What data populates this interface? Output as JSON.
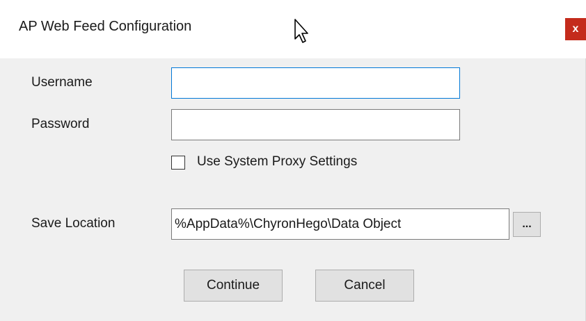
{
  "window": {
    "title": "AP Web Feed Configuration",
    "close_label": "x"
  },
  "form": {
    "username_label": "Username",
    "username_value": "",
    "password_label": "Password",
    "password_value": "",
    "proxy_checkbox_label": "Use System Proxy Settings",
    "proxy_checked": false,
    "save_location_label": "Save Location",
    "save_location_value": "%AppData%\\ChyronHego\\Data Object",
    "browse_label": "..."
  },
  "buttons": {
    "continue_label": "Continue",
    "cancel_label": "Cancel"
  },
  "colors": {
    "close_button": "#c42b1c",
    "focus_border": "#0078d7",
    "dialog_background": "#f0f0f0"
  }
}
